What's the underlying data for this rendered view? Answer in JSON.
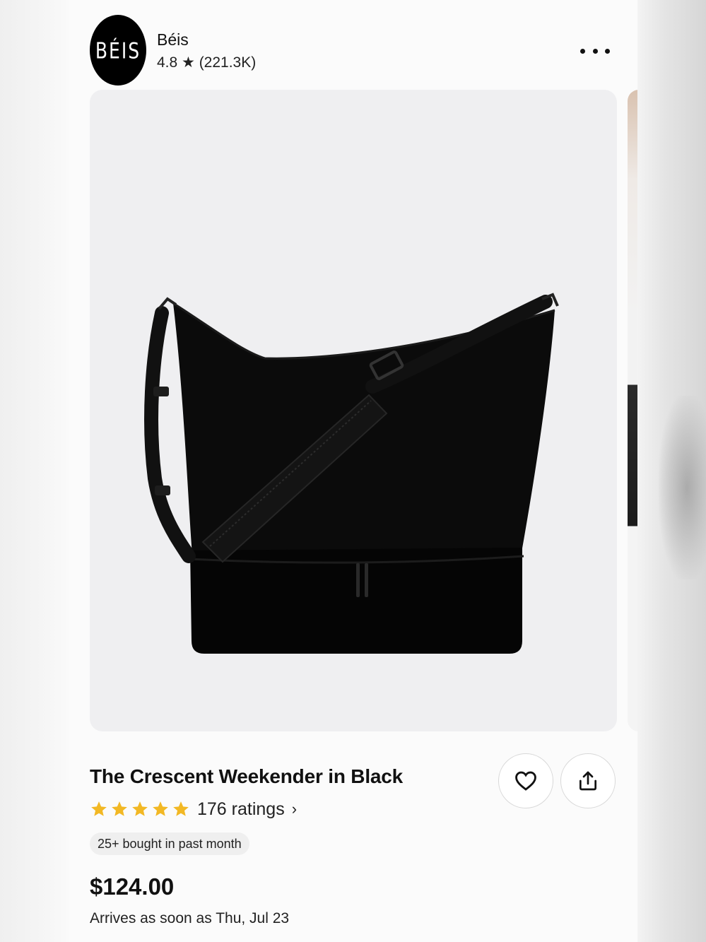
{
  "shop": {
    "logo_text": "BÉIS",
    "name": "Béis",
    "rating_summary": "4.8 ★ (221.3K)"
  },
  "product": {
    "image_icon": "black-crescent-weekender-bag-photo",
    "title": "The Crescent Weekender in Black",
    "star_rating": 5,
    "star_color": "#F2B824",
    "ratings_label": "176 ratings",
    "ratings_chevron": "›",
    "bought_badge": "25+ bought in past month",
    "price": "$124.00",
    "delivery": "Arrives as soon as Thu, Jul 23"
  },
  "actions": {
    "more_icon": "more-horizontal-icon",
    "favorite_icon": "heart-outline-icon",
    "share_icon": "share-upload-icon"
  }
}
